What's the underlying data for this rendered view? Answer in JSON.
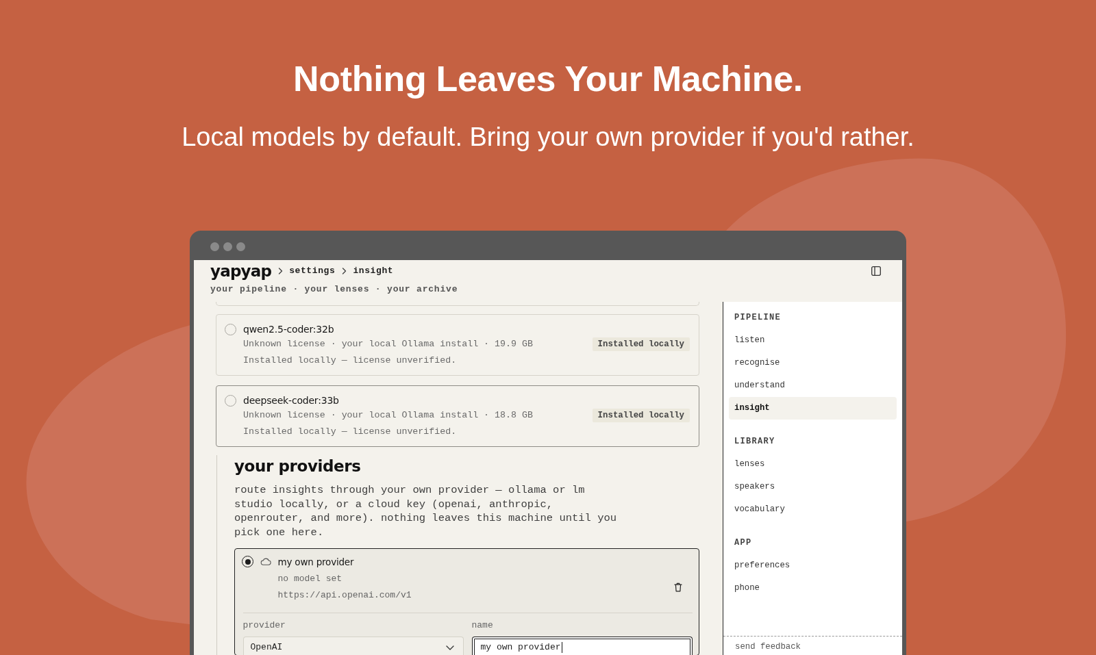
{
  "hero": {
    "title": "Nothing Leaves Your Machine.",
    "subtitle": "Local models by default. Bring your own provider if you'd rather."
  },
  "window": {
    "header": {
      "logo": "yapyap",
      "breadcrumbs": [
        "settings",
        "insight"
      ],
      "tagline": "your pipeline · your lenses · your archive"
    },
    "models": [
      {
        "name": "qwen2.5-coder:32b",
        "selected": false,
        "hovered": false,
        "meta": "Unknown license · your local Ollama install · 19.9 GB",
        "badge": "Installed locally",
        "note": "Installed locally — license unverified."
      },
      {
        "name": "deepseek-coder:33b",
        "selected": false,
        "hovered": true,
        "meta": "Unknown license · your local Ollama install · 18.8 GB",
        "badge": "Installed locally",
        "note": "Installed locally — license unverified."
      }
    ],
    "providers": {
      "heading": "your providers",
      "description": "route insights through your own provider — ollama or lm studio locally, or a cloud key (openai, anthropic, openrouter, and more). nothing leaves this machine until you pick one here.",
      "items": [
        {
          "name": "my own provider",
          "selected": true,
          "model": "no model set",
          "url": "https://api.openai.com/v1",
          "fields": [
            {
              "kind": "select",
              "label": "provider",
              "value": "OpenAI",
              "focused": false
            },
            {
              "kind": "text",
              "label": "name",
              "value": "my own provider",
              "focused": true
            }
          ]
        }
      ]
    },
    "sidebar": {
      "groups": [
        {
          "heading": "PIPELINE",
          "items": [
            {
              "label": "listen",
              "selected": false
            },
            {
              "label": "recognise",
              "selected": false
            },
            {
              "label": "understand",
              "selected": false
            },
            {
              "label": "insight",
              "selected": true
            }
          ]
        },
        {
          "heading": "LIBRARY",
          "items": [
            {
              "label": "lenses",
              "selected": false
            },
            {
              "label": "speakers",
              "selected": false
            },
            {
              "label": "vocabulary",
              "selected": false
            }
          ]
        },
        {
          "heading": "APP",
          "items": [
            {
              "label": "preferences",
              "selected": false
            },
            {
              "label": "phone",
              "selected": false
            }
          ]
        }
      ],
      "footer": "send feedback"
    }
  }
}
